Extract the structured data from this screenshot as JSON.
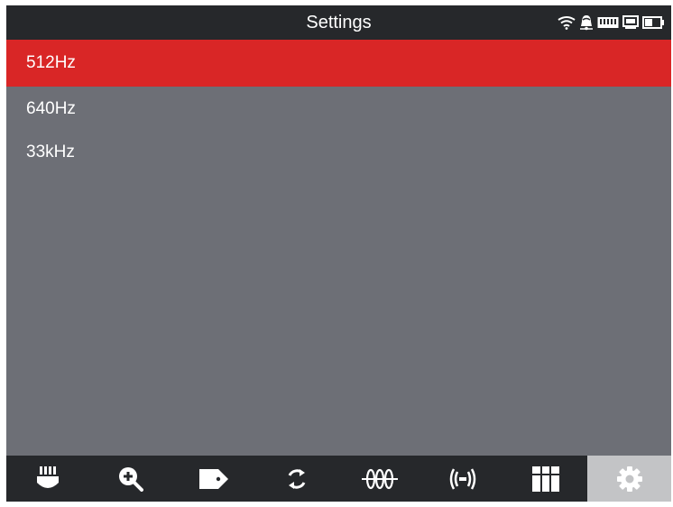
{
  "header": {
    "title": "Settings",
    "status_icons": [
      "wifi-icon",
      "bell-icon",
      "memory-icon",
      "display-icon",
      "battery-icon"
    ]
  },
  "frequency_list": {
    "items": [
      {
        "label": "512Hz",
        "selected": true
      },
      {
        "label": "640Hz",
        "selected": false
      },
      {
        "label": "33kHz",
        "selected": false
      }
    ]
  },
  "toolbar": {
    "items": [
      {
        "icon": "probe-icon",
        "active": false
      },
      {
        "icon": "zoom-in-icon",
        "active": false
      },
      {
        "icon": "tag-icon",
        "active": false
      },
      {
        "icon": "refresh-icon",
        "active": false
      },
      {
        "icon": "signal-wave-icon",
        "active": false
      },
      {
        "icon": "broadcast-icon",
        "active": false
      },
      {
        "icon": "grid-icon",
        "active": false
      },
      {
        "icon": "gear-icon",
        "active": true
      }
    ]
  },
  "colors": {
    "selected_row": "#d92626",
    "background": "#6d6f76",
    "bar": "#26282b",
    "active_tool": "#c3c4c6"
  }
}
